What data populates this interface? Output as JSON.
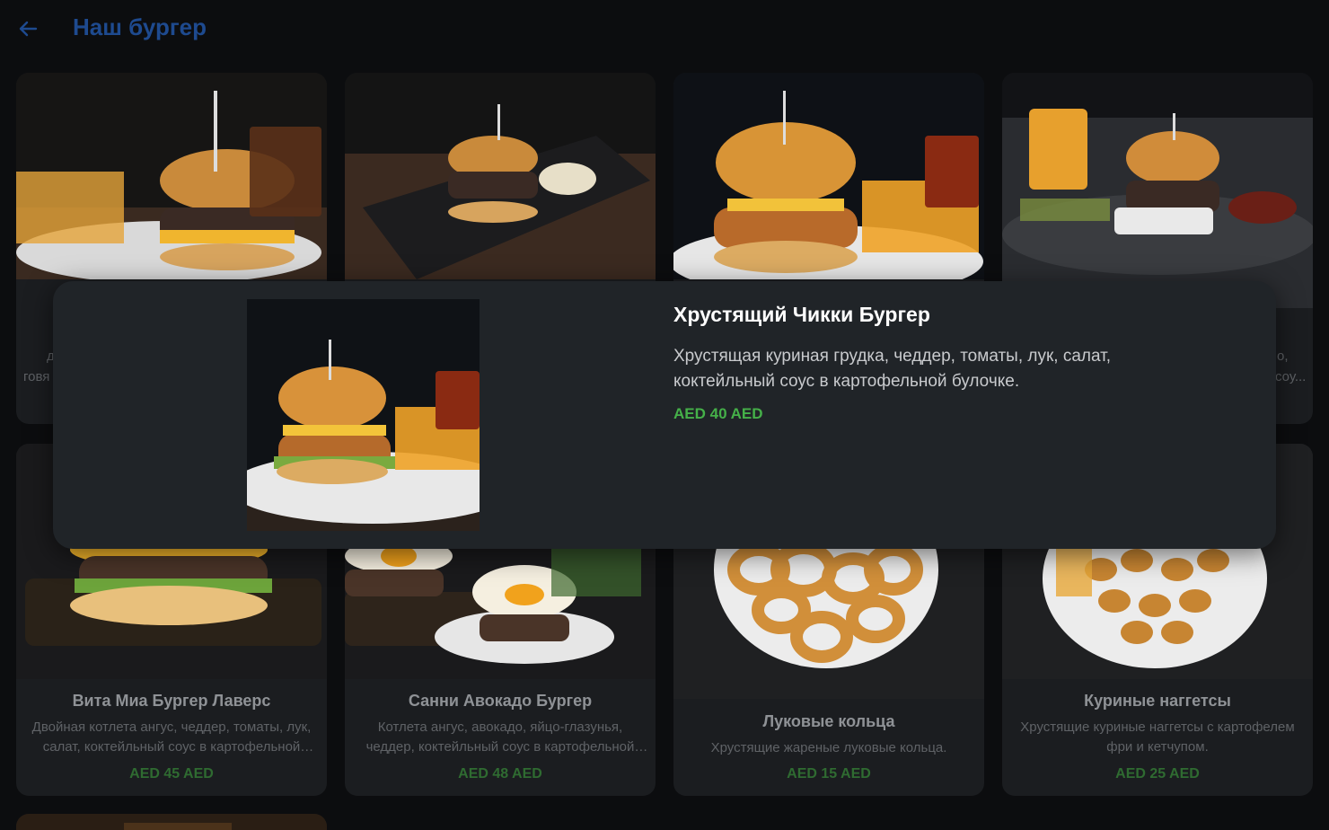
{
  "header": {
    "title": "Наш бургер"
  },
  "cards": [
    {
      "title": "",
      "desc": "",
      "price": ""
    },
    {
      "title": "",
      "desc": "",
      "price": ""
    },
    {
      "title": "",
      "desc": "",
      "price": ""
    },
    {
      "title": "",
      "desc": "",
      "price": ""
    },
    {
      "title": "Вита Миа Бургер Лаверс",
      "desc": "Двойная котлета ангус, чеддер, томаты, лук, салат, коктейльный соус в картофельной булочке.",
      "price": "AED 45 AED"
    },
    {
      "title": "Санни Авокадо Бургер",
      "desc": "Котлета ангус, авокадо, яйцо-глазунья, чеддер, коктейльный соус в картофельной булочке.",
      "price": "AED 48 AED"
    },
    {
      "title": "Луковые кольца",
      "desc": "Хрустящие жареные луковые кольца.",
      "price": "AED 15 AED"
    },
    {
      "title": "Куриные наггетсы",
      "desc": "Хрустящие куриные наггетсы с картофелем фри и кетчупом.",
      "price": "AED 25 AED"
    }
  ],
  "peek": {
    "left_line1": "д",
    "left_line2": "говя",
    "right_line1": "о,",
    "right_line2": "соу..."
  },
  "modal": {
    "title": "Хрустящий Чикки Бургер",
    "desc": "Хрустящая куриная грудка, чеддер, томаты, лук, салат, коктейльный соус в картофельной булочке.",
    "price": "AED 40 AED"
  },
  "colors": {
    "background": "#0c0d0f",
    "card": "#1b1d20",
    "modal": "#202428",
    "title_blue": "#1e4a8f",
    "price_green": "#45b049",
    "price_green_dim": "#2f6b31"
  },
  "icons": {
    "back": "arrow-left-icon"
  }
}
